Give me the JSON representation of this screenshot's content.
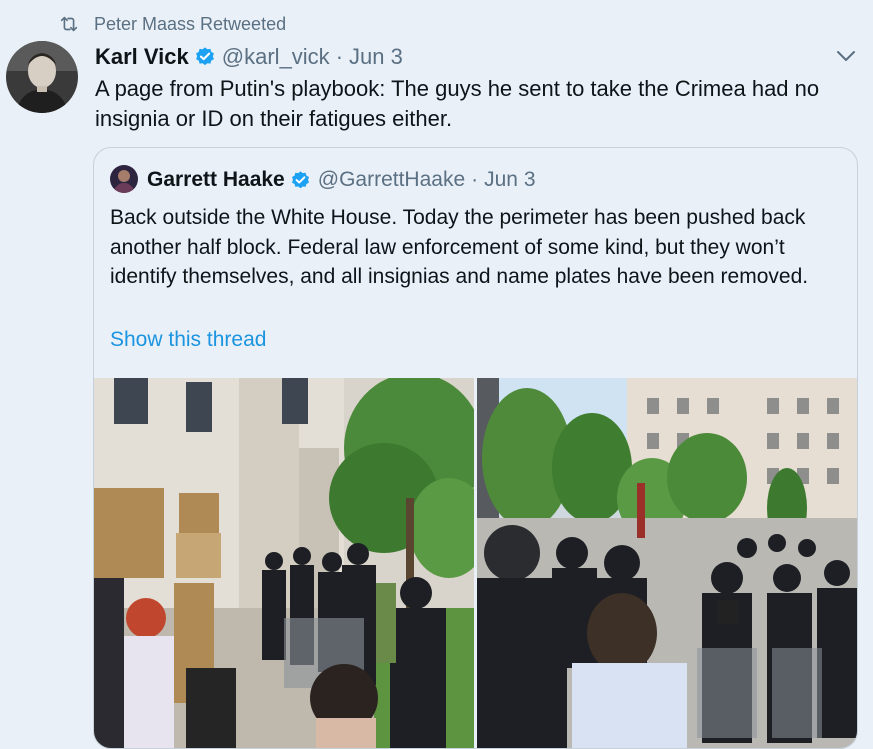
{
  "retweet": {
    "icon": "retweet-icon",
    "text": "Peter Maass Retweeted"
  },
  "tweet": {
    "author_name": "Karl Vick",
    "handle": "@karl_vick",
    "separator": "·",
    "date": "Jun 3",
    "text": "A page from Putin's playbook: The guys he sent to take the Crimea had no insignia or ID on their fatigues either."
  },
  "quote": {
    "author_name": "Garrett Haake",
    "handle": "@GarrettHaake",
    "separator": "·",
    "date": "Jun 3",
    "text": "Back outside the White House. Today the perimeter has been pushed back another half block. Federal law enforcement of some kind, but they won’t identify themselves, and all insignias and name plates have been removed.",
    "show_thread": "Show this thread"
  },
  "colors": {
    "accent": "#1b95e0",
    "muted": "#5b7083",
    "background": "#e9f0f7",
    "verified": "#1da1f2"
  }
}
